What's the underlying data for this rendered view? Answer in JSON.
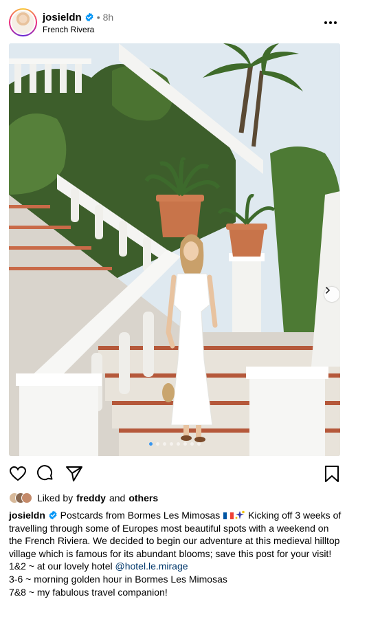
{
  "post": {
    "username": "josieldn",
    "separator": "•",
    "time": "8h",
    "location": "French Rivera"
  },
  "photo": {
    "alt": "Woman in white dress on a white balustrade staircase with potted palms",
    "carousel_count": 8,
    "carousel_active": 1
  },
  "actions": {
    "icons": [
      "heart-icon",
      "comment-icon",
      "share-icon",
      "bookmark-icon"
    ]
  },
  "likes": {
    "prefix": "Liked by",
    "user": "freddy",
    "conjunction": "and",
    "others": "others"
  },
  "caption": {
    "username": "josieldn",
    "text_1": " Postcards from Bormes Les Mimosas ",
    "text_2": " Kicking off 3 weeks of travelling through some of Europes most beautiful spots with a weekend on the French Riviera. We decided to begin our adventure at this medieval hilltop village which is famous for its abundant blooms; save this post for your visit!",
    "line_1_text": "1&2 ~ at our lovely hotel ",
    "line_1_mention": "@hotel.le.mirage",
    "line_2": "3-6 ~ morning golden hour in Bormes Les Mimosas",
    "line_3": "7&8 ~ my fabulous travel companion!"
  },
  "colors": {
    "verified": "#0095f6",
    "mention": "#00376b",
    "secondary_text": "#737373",
    "carousel_active": "#3897f0"
  }
}
